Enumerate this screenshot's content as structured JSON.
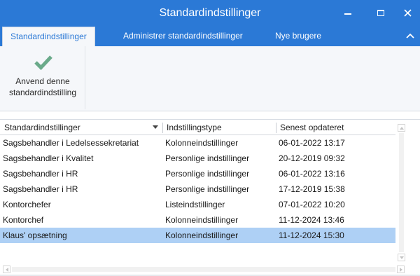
{
  "window": {
    "title": "Standardindstillinger",
    "controls": {
      "minimize": "minimize-icon",
      "maximize": "maximize-icon",
      "close": "close-icon"
    }
  },
  "ribbon": {
    "tabs": [
      {
        "label": "Standardindstillinger",
        "active": true
      },
      {
        "label": "Administrer standardindstillinger",
        "active": false
      },
      {
        "label": "Nye brugere",
        "active": false
      }
    ],
    "collapse_icon": "chevron-up-icon",
    "apply_button": {
      "line1": "Anvend denne",
      "line2": "standardindstilling",
      "icon": "checkmark-icon",
      "icon_color": "#6aaa8a"
    }
  },
  "grid": {
    "columns": [
      "Standardindstillinger",
      "Indstillingstype",
      "Senest opdateret"
    ],
    "sort_icon": "sort-descending-icon",
    "rows": [
      {
        "name": "Sagsbehandler i Ledelsessekretariat",
        "type": "Kolonneindstillinger",
        "updated": "06-01-2022 13:17",
        "selected": false
      },
      {
        "name": "Sagsbehandler i Kvalitet",
        "type": "Personlige indstillinger",
        "updated": "20-12-2019 09:32",
        "selected": false
      },
      {
        "name": "Sagsbehandler i HR",
        "type": "Personlige indstillinger",
        "updated": "06-01-2022 13:16",
        "selected": false
      },
      {
        "name": "Sagsbehandler i HR",
        "type": "Personlige indstillinger",
        "updated": "17-12-2019 15:38",
        "selected": false
      },
      {
        "name": "Kontorchefer",
        "type": "Listeindstillinger",
        "updated": "07-01-2022 10:20",
        "selected": false
      },
      {
        "name": "Kontorchef",
        "type": "Kolonneindstillinger",
        "updated": "11-12-2024 13:46",
        "selected": false
      },
      {
        "name": "Klaus' opsætning",
        "type": "Kolonneindstillinger",
        "updated": "11-12-2024 15:30",
        "selected": true
      }
    ]
  },
  "colors": {
    "titlebar": "#2b79d6",
    "selected_row": "#aed0f5",
    "ribbon_bg": "#f5f7fa"
  }
}
